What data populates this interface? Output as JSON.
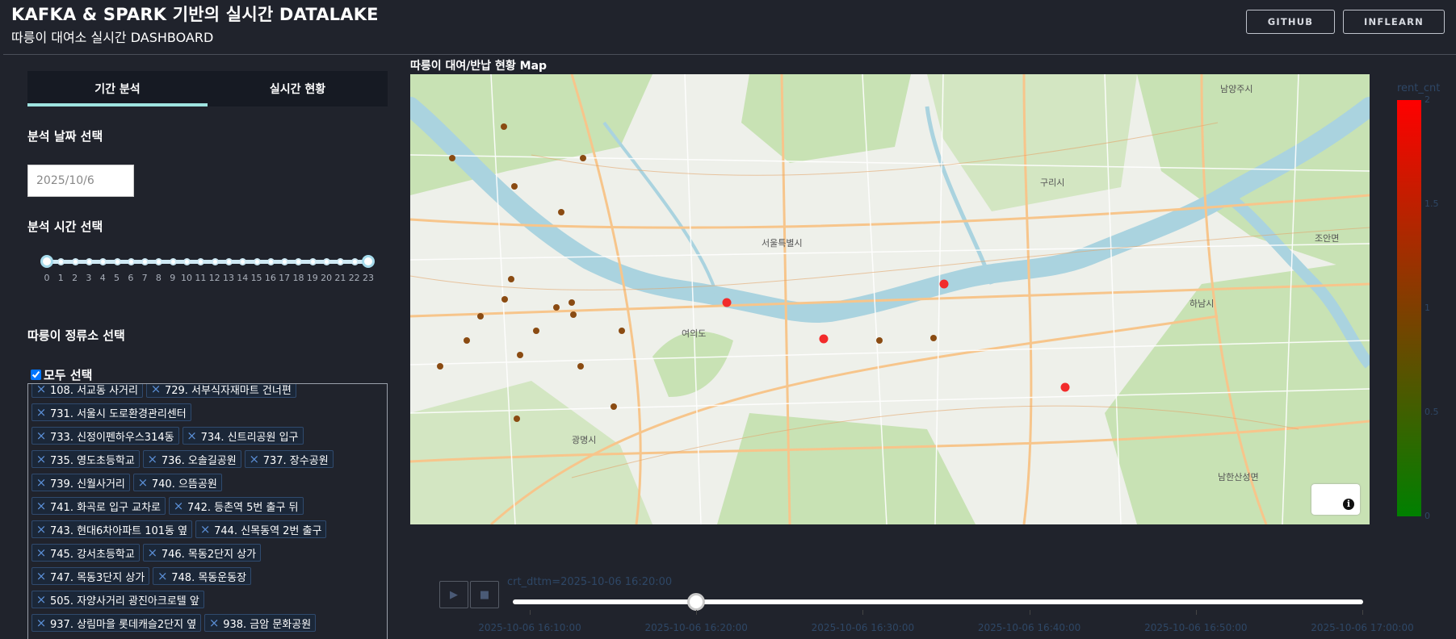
{
  "header": {
    "title": "KAFKA & SPARK 기반의 실시간 DATALAKE",
    "subtitle": "따릉이 대여소 실시간 DASHBOARD",
    "buttons": [
      {
        "label": "GITHUB"
      },
      {
        "label": "INFLEARN"
      }
    ]
  },
  "tabs": [
    {
      "label": "기간 분석",
      "active": true
    },
    {
      "label": "실시간 현황",
      "active": false
    }
  ],
  "filters": {
    "date_label": "분석 날짜 선택",
    "date_placeholder": "2025/10/6",
    "hour_label": "분석 시간 선택",
    "hour_ticks": [
      "0",
      "1",
      "2",
      "3",
      "4",
      "5",
      "6",
      "7",
      "8",
      "9",
      "10",
      "11",
      "12",
      "13",
      "14",
      "15",
      "16",
      "17",
      "18",
      "19",
      "20",
      "21",
      "22",
      "23"
    ],
    "hour_range": [
      0,
      23
    ],
    "station_label": "따릉이 정류소 선택",
    "select_all_label": "모두 선택",
    "select_all_checked": true
  },
  "stations": [
    [
      "108. 서교동 사거리",
      "729. 서부식자재마트 건너편"
    ],
    [
      "731. 서울시 도로환경관리센터"
    ],
    [
      "733. 신정이펜하우스314동",
      "734. 신트리공원 입구"
    ],
    [
      "735. 영도초등학교",
      "736. 오솔길공원",
      "737. 장수공원"
    ],
    [
      "739. 신월사거리",
      "740. 으뜸공원"
    ],
    [
      "741. 화곡로 입구 교차로",
      "742. 등촌역 5번 출구 뒤"
    ],
    [
      "743. 현대6차아파트 101동 옆",
      "744. 신목동역 2번 출구"
    ],
    [
      "745. 강서초등학교",
      "746. 목동2단지 상가"
    ],
    [
      "747. 목동3단지 상가",
      "748. 목동운동장"
    ],
    [
      "505. 자양사거리 광진아크로텔 앞"
    ],
    [
      "937. 상림마을 롯데캐슬2단지 옆",
      "938. 금암 문화공원"
    ]
  ],
  "map": {
    "title": "따릉이 대여/반납 현황 Map",
    "place_labels": [
      "남양주시",
      "구리시",
      "서울특별시",
      "하남시",
      "광명시",
      "조안면",
      "남한산성면",
      "여의도"
    ],
    "river_color": "#aad3df",
    "park_color": "#c8e2b4"
  },
  "colorbar": {
    "title": "rent_cnt",
    "ticks": [
      "2",
      "1.5",
      "1",
      "0.5",
      "0"
    ],
    "colors": [
      "#ff0000",
      "#7f3f00",
      "#008000"
    ]
  },
  "animation": {
    "play_icon": "play-icon",
    "stop_icon": "stop-icon",
    "frame_label": "crt_dttm=2025-10-06 16:20:00",
    "tick_labels": [
      "2025-10-06 16:10:00",
      "2025-10-06 16:20:00",
      "2025-10-06 16:30:00",
      "2025-10-06 16:40:00",
      "2025-10-06 16:50:00",
      "2025-10-06 17:00:00"
    ],
    "current_fraction": 0.2
  }
}
